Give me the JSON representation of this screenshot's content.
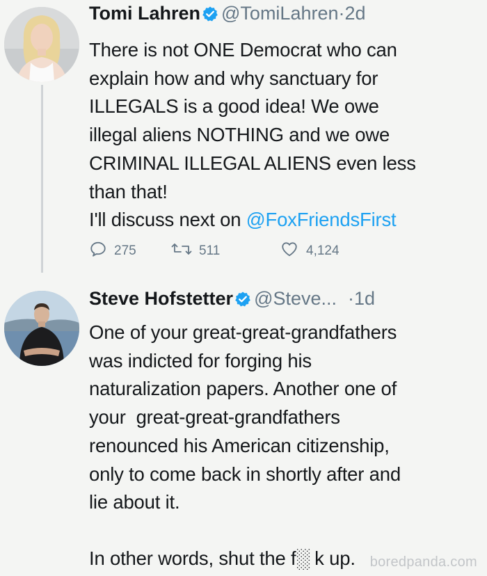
{
  "tweet1": {
    "name": "Tomi Lahren",
    "handle": "@TomiLahren",
    "separator": "·",
    "time": "2d",
    "text_lines": [
      "There is not ONE Democrat who can",
      "explain how and why sanctuary for",
      "ILLEGALS is a good idea! We owe",
      "illegal aliens NOTHING and we owe",
      "CRIMINAL ILLEGAL ALIENS even less",
      "than that!"
    ],
    "text_last_prefix": "I'll discuss next on ",
    "mention": "@FoxFriendsFirst",
    "replies": "275",
    "retweets": "511",
    "likes": "4,124"
  },
  "tweet2": {
    "name": "Steve Hofstetter",
    "handle": "@Steve...",
    "separator": "·",
    "time": "1d",
    "text_lines": [
      "One of your great-great-grandfathers",
      "was indicted for forging his",
      "naturalization papers. Another one of",
      "your  great-great-grandfathers",
      "renounced his American citizenship,",
      "only to come back in shortly after and",
      "lie about it."
    ],
    "closing": "In other words, shut the f░ k up."
  },
  "watermark": "boredpanda.com",
  "colors": {
    "background": "#f4f5f3",
    "text": "#14171a",
    "muted": "#657786",
    "link": "#1da1f2",
    "verified": "#1da1f2"
  },
  "icons": [
    "verified-badge-icon",
    "reply-icon",
    "retweet-icon",
    "like-icon"
  ]
}
